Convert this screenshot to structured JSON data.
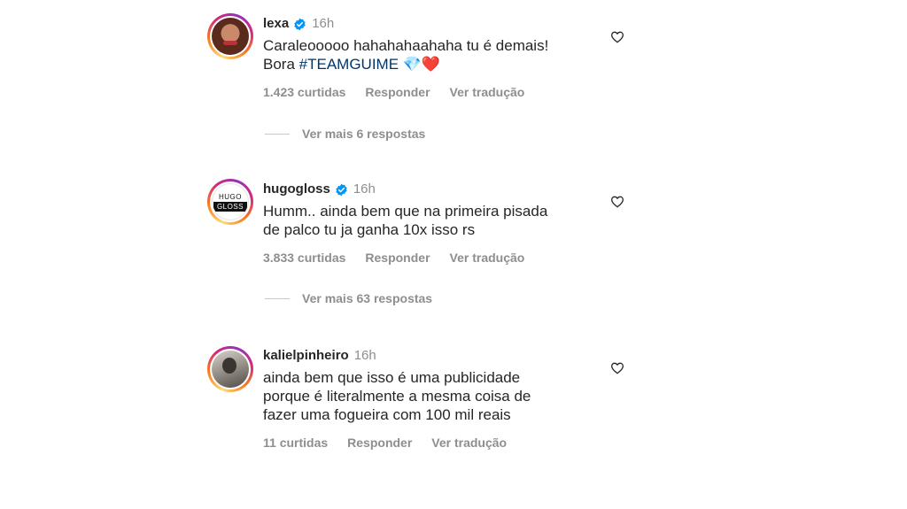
{
  "comments": [
    {
      "username": "lexa",
      "verified": true,
      "time": "16h",
      "text_line1": "Caraleooooo hahahahaahaha tu é demais!",
      "text_line2_prefix": "Bora ",
      "hashtag": "#TEAMGUIME",
      "emoji": " 💎❤️",
      "likes": "1.423 curtidas",
      "reply": "Responder",
      "translate": "Ver tradução",
      "more_replies": "Ver mais 6 respostas"
    },
    {
      "username": "hugogloss",
      "verified": true,
      "time": "16h",
      "avatar_text_top": "HUGO",
      "avatar_text_bottom": "GLOSS",
      "text_line1": "Humm.. ainda bem que na primeira pisada",
      "text_line2": "de palco tu ja ganha 10x isso rs",
      "likes": "3.833 curtidas",
      "reply": "Responder",
      "translate": "Ver tradução",
      "more_replies": "Ver mais 63 respostas"
    },
    {
      "username": "kalielpinheiro",
      "verified": false,
      "time": "16h",
      "text_line1": "ainda bem que isso é uma publicidade",
      "text_line2": "porque é literalmente a mesma coisa de",
      "text_line3": "fazer uma fogueira com 100 mil reais",
      "likes": "11 curtidas",
      "reply": "Responder",
      "translate": "Ver tradução"
    }
  ],
  "colors": {
    "text": "#262626",
    "secondary": "#8e8e8e",
    "hashtag": "#00376b",
    "verified": "#0095f6"
  },
  "icons": {
    "like": "heart-outline-icon",
    "verified": "verified-badge-icon"
  }
}
